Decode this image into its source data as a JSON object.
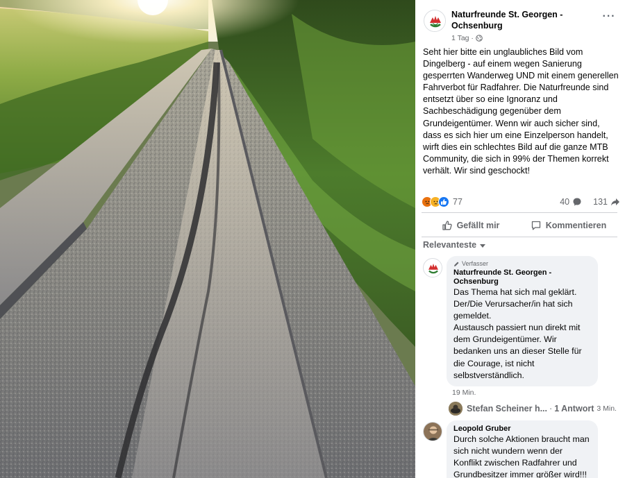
{
  "photo": {
    "description_icon": "photo-dirt-path-with-tire-tracks"
  },
  "post": {
    "page_name": "Naturfreunde St. Georgen - Ochsenburg",
    "time": "1 Tag ·",
    "privacy_icon": "globe-icon",
    "more_icon": "more-icon",
    "more_label": "···",
    "text": "Seht hier bitte ein unglaubliches Bild vom Dingelberg - auf einem wegen Sanierung gesperrten Wanderweg UND mit einem generellen Fahrverbot für Radfahrer. Die Naturfreunde sind entsetzt über so eine Ignoranz und Sachbeschädigung gegenüber dem Grundeigentümer. Wenn wir auch sicher sind, dass es sich hier um eine Einzelperson handelt, wirft dies ein schlechtes Bild auf die ganze MTB Community, die sich in 99% der Themen korrekt verhält. Wir sind geschockt!"
  },
  "reactions": {
    "icons": [
      "angry-reaction-icon",
      "sad-reaction-icon",
      "like-reaction-icon"
    ],
    "count": "77",
    "comments_count": "40",
    "shares_count": "131"
  },
  "actions": {
    "like_label": "Gefällt mir",
    "comment_label": "Kommentieren"
  },
  "sort": {
    "label": "Relevanteste"
  },
  "comments": [
    {
      "badge": "Verfasser",
      "author": "Naturfreunde St. Georgen - Ochsenburg",
      "text_lines": [
        "Das Thema hat sich mal geklärt.",
        "Der/Die Verursacher/in hat sich gemeldet.",
        "Austausch passiert nun direkt mit dem Grundeigentümer. Wir bedanken uns an dieser Stelle für die Courage, ist nicht selbstverständlich."
      ],
      "time": "19 Min.",
      "reply": {
        "name": "Stefan Scheiner h...",
        "separator": "·",
        "count": "1 Antwort",
        "time": "3 Min."
      }
    },
    {
      "author": "Leopold Gruber",
      "text": "Durch solche Aktionen braucht man sich nicht wundern wenn der Konflikt zwischen Radfahrer und Grundbesitzer immer größer wird!!!"
    }
  ],
  "colors": {
    "accent": "#1877f2",
    "secondary_text": "#65676b",
    "bubble": "#f0f2f5"
  }
}
